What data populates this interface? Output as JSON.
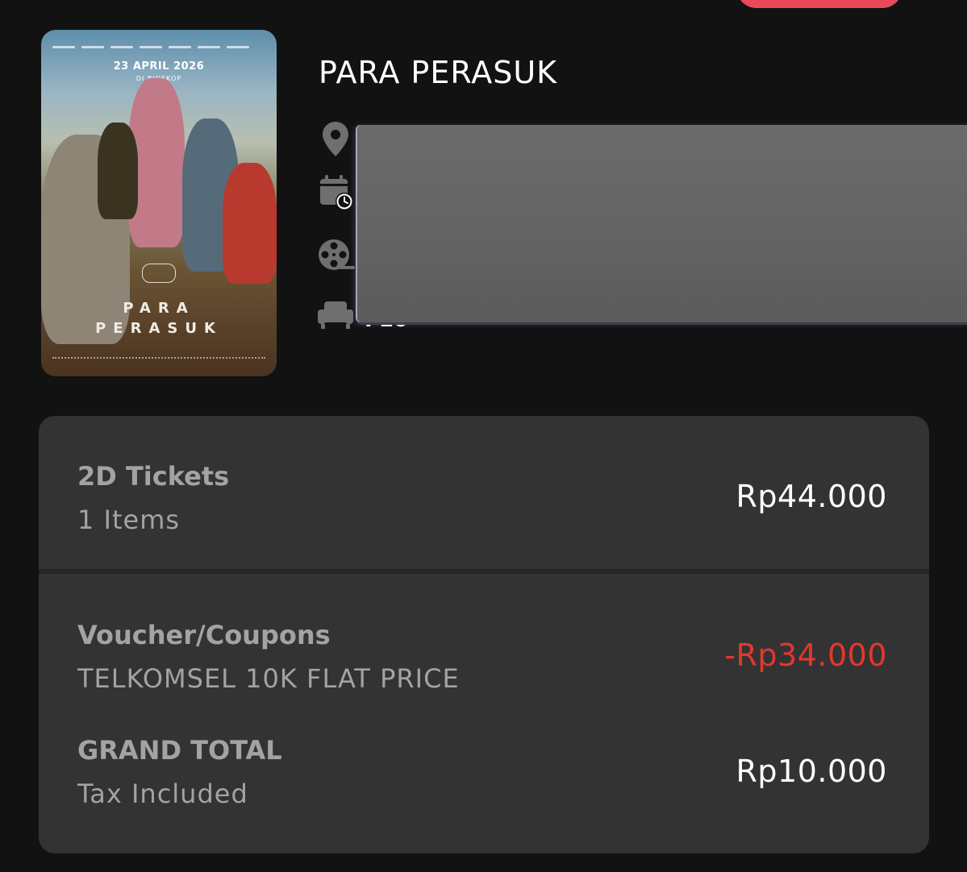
{
  "movie": {
    "title": "PARA PERASUK",
    "poster": {
      "release_date": "23 APRIL 2026",
      "release_note": "DI BIOSKOP",
      "title_line1": "PARA",
      "title_line2": "PERASUK"
    }
  },
  "info_icons": [
    "location-pin-icon",
    "calendar-clock-icon",
    "film-reel-icon",
    "seat-icon"
  ],
  "seat_value_partial": "F10",
  "summary": {
    "tickets": {
      "label": "2D Tickets",
      "sub": "1 Items",
      "amount": "Rp44.000"
    },
    "voucher": {
      "label": "Voucher/Coupons",
      "sub": "TELKOMSEL 10K FLAT PRICE",
      "amount": "-Rp34.000"
    },
    "total": {
      "label": "GRAND TOTAL",
      "sub": "Tax Included",
      "amount": "Rp10.000"
    }
  },
  "colors": {
    "background": "#121212",
    "card": "#333333",
    "muted_text": "#a3a3a3",
    "discount": "#e3372e",
    "accent_pill": "#e84a5a",
    "icon": "#6f6f6f"
  }
}
